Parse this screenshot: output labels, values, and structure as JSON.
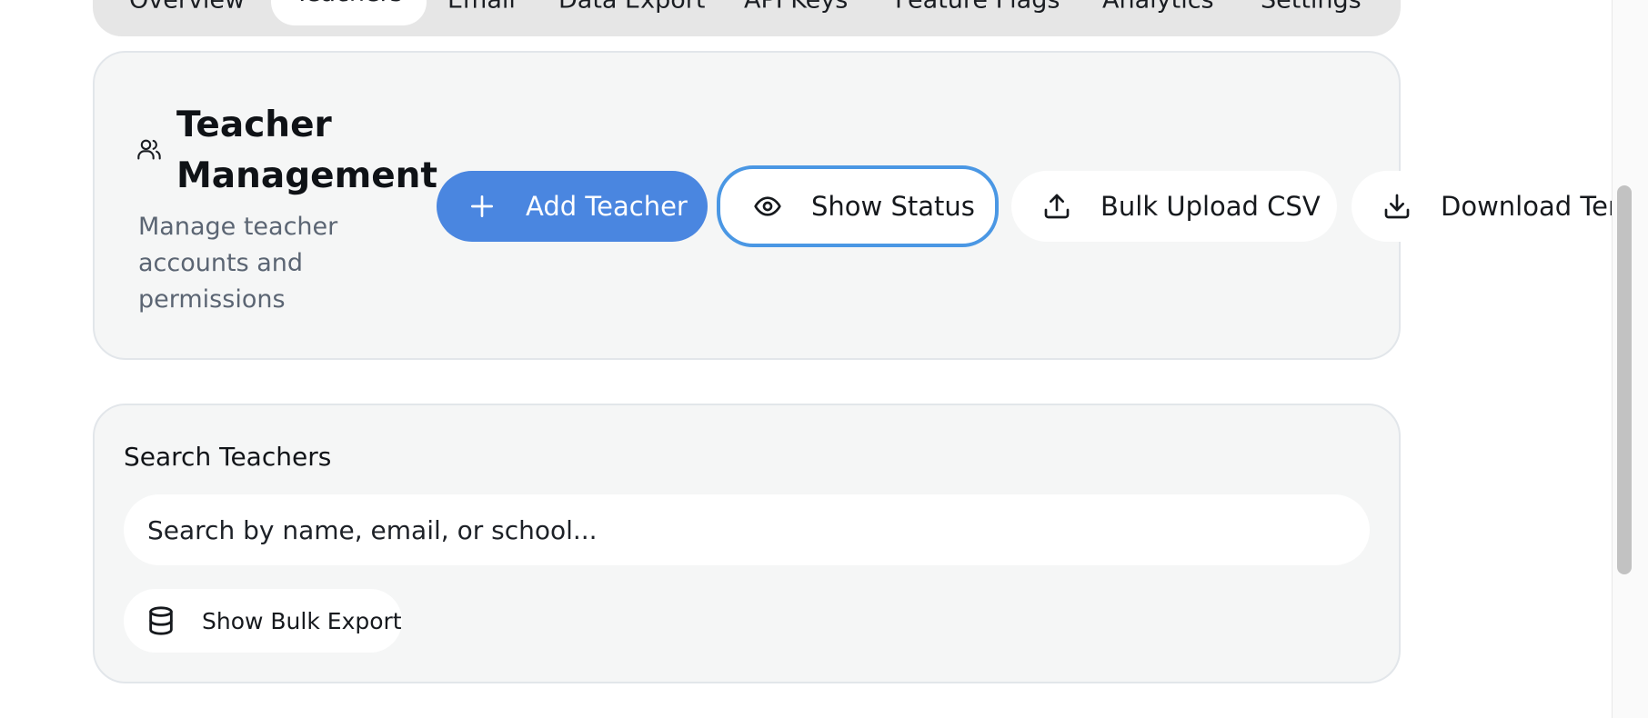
{
  "tabs": [
    {
      "label": "Overview"
    },
    {
      "label": "Teachers"
    },
    {
      "label": "Email"
    },
    {
      "label": "Data Export"
    },
    {
      "label": "API Keys"
    },
    {
      "label": "Feature Flags"
    },
    {
      "label": "Analytics"
    },
    {
      "label": "Settings"
    }
  ],
  "active_tab": "Teachers",
  "header": {
    "icon": "users-icon",
    "title": "Teacher Management",
    "subtitle": "Manage teacher accounts and permissions"
  },
  "actions": {
    "add_teacher": {
      "label": "Add Teacher",
      "icon": "plus-icon"
    },
    "show_status": {
      "label": "Show Status",
      "icon": "eye-icon"
    },
    "bulk_upload": {
      "label": "Bulk Upload CSV",
      "icon": "upload-icon"
    },
    "download_template": {
      "label": "Download Tem",
      "icon": "download-icon"
    }
  },
  "search": {
    "label": "Search Teachers",
    "placeholder": "Search by name, email, or school...",
    "value": ""
  },
  "bulk_export": {
    "label": "Show Bulk Export",
    "icon": "database-icon"
  },
  "colors": {
    "primary": "#4a86e0",
    "focus_ring": "#4a97e4",
    "card_bg": "#f5f6f6",
    "muted_text": "#5b6573"
  }
}
